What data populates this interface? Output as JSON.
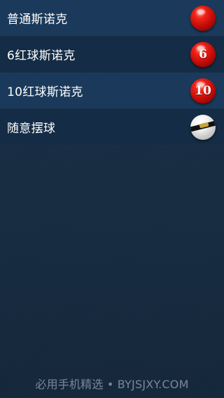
{
  "menu": {
    "items": [
      {
        "label": "普通斯诺克",
        "ball_number": "",
        "ball_icon": "red-ball-icon"
      },
      {
        "label": "6红球斯诺克",
        "ball_number": "6",
        "ball_icon": "red-ball-6-icon"
      },
      {
        "label": "10红球斯诺克",
        "ball_number": "10",
        "ball_icon": "red-ball-10-icon"
      },
      {
        "label": "随意摆球",
        "ball_number": "",
        "ball_icon": "cue-ball-icon"
      }
    ]
  },
  "watermark": {
    "text": "必用手机精选 • BYJSJXY.COM"
  },
  "colors": {
    "row_light": "#1b3a5b",
    "row_dark": "#142c45",
    "background": "#15283b",
    "ball_red": "#d01a12",
    "text": "#ffffff"
  }
}
